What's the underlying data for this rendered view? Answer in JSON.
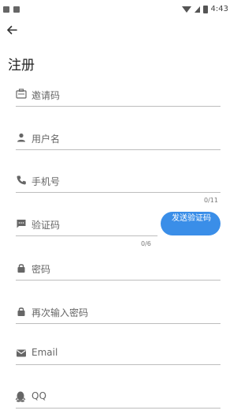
{
  "status_bar": {
    "time": "4:43"
  },
  "page": {
    "title": "注册"
  },
  "fields": [
    {
      "label": "邀请码",
      "icon": "card-icon"
    },
    {
      "label": "用户名",
      "icon": "person-icon"
    },
    {
      "label": "手机号",
      "icon": "phone-icon"
    },
    {
      "label": "验证码",
      "icon": "message-icon"
    },
    {
      "label": "密码",
      "icon": "lock-icon"
    },
    {
      "label": "再次输入密码",
      "icon": "lock-icon"
    },
    {
      "label": "Email",
      "icon": "email-icon"
    },
    {
      "label": "QQ",
      "icon": "qq-icon"
    }
  ],
  "counters": {
    "phone": "0/11",
    "code": "0/6"
  },
  "send_code": {
    "label": "发送验证码"
  },
  "colors": {
    "accent": "#3a8ee8",
    "divider": "#bdbdbd",
    "icon": "#666666"
  }
}
